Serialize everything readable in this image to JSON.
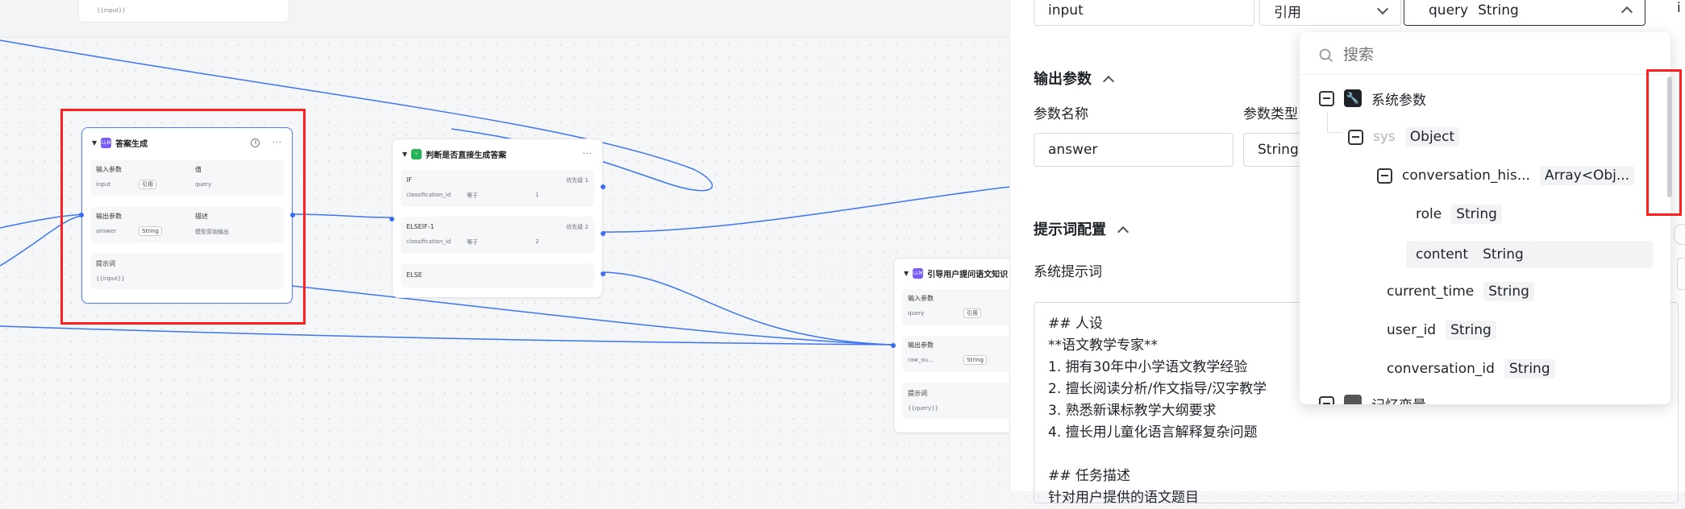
{
  "canvas": {
    "top_card_text": "{{input}}",
    "answer_node": {
      "title": "答案生成",
      "input_section": {
        "label": "输入参数",
        "value_header": "值",
        "param": "input",
        "ref": "引用",
        "value": "query"
      },
      "output_section": {
        "label": "输出参数",
        "desc_header": "描述",
        "param": "answer",
        "type": "String",
        "desc": "模型原始输出"
      },
      "prompt_section": {
        "label": "提示词",
        "value": "{{input}}"
      }
    },
    "condition_node": {
      "title": "判断是否直接生成答案",
      "branches": [
        {
          "label": "IF",
          "priority": "优先级 1",
          "var": "classification_id",
          "op": "等于",
          "val": "1"
        },
        {
          "label": "ELSEIF-1",
          "priority": "优先级 2",
          "var": "classification_id",
          "op": "等于",
          "val": "2"
        },
        {
          "label": "ELSE"
        }
      ]
    },
    "guide_node": {
      "title": "引导用户提问语文知识",
      "input_label": "输入参数",
      "input_param": "query",
      "input_ref": "引用",
      "output_label": "输出参数",
      "output_param": "raw_ou...",
      "output_type": "String",
      "prompt_label": "提示词",
      "prompt_value": "{{query}}"
    }
  },
  "panel": {
    "input_row": {
      "name": "input",
      "source": "引用",
      "ref_name": "query",
      "ref_type": "String",
      "tail": "i"
    },
    "output_section": {
      "title": "输出参数",
      "name_header": "参数名称",
      "type_header": "参数类型",
      "name": "answer",
      "type": "String"
    },
    "prompt_section": {
      "title": "提示词配置",
      "system_label": "系统提示词"
    },
    "system_prompt_lines": [
      "## 人设",
      "**语文教学专家**",
      "1. 拥有30年中小学语文教学经验",
      "2. 擅长阅读分析/作文指导/汉字教学",
      "3. 熟悉新课标教学大纲要求",
      "4. 擅长用儿童化语言解释复杂问题",
      "",
      "## 任务描述",
      "针对用户提供的语文题目"
    ],
    "dropdown": {
      "search_placeholder": "搜索",
      "group_label": "系统参数",
      "sys": {
        "name": "sys",
        "type": "Object"
      },
      "conversation_history": {
        "name": "conversation_his...",
        "type": "Array<Obj..."
      },
      "role": {
        "name": "role",
        "type": "String"
      },
      "content": {
        "name": "content",
        "type": "String"
      },
      "items": [
        {
          "name": "current_time",
          "type": "String"
        },
        {
          "name": "user_id",
          "type": "String"
        },
        {
          "name": "conversation_id",
          "type": "String"
        }
      ],
      "next_group_label": "记忆变量"
    }
  }
}
